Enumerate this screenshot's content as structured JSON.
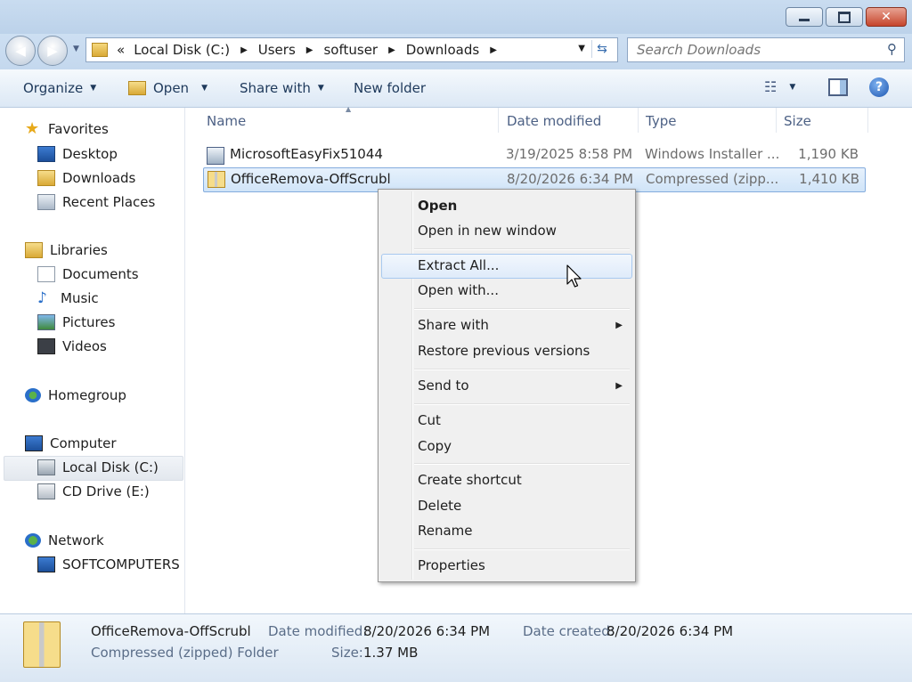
{
  "window": {
    "buttons": {
      "minimize": "minimize",
      "maximize": "maximize",
      "close": "close"
    }
  },
  "address": {
    "overflow": "«",
    "crumbs": [
      "Local Disk (C:)",
      "Users",
      "softuser",
      "Downloads"
    ],
    "search_placeholder": "Search Downloads"
  },
  "toolbar": {
    "organize": "Organize",
    "open": "Open",
    "share_with": "Share with",
    "new_folder": "New folder"
  },
  "sidebar": {
    "favorites": {
      "label": "Favorites",
      "items": [
        "Desktop",
        "Downloads",
        "Recent Places"
      ]
    },
    "libraries": {
      "label": "Libraries",
      "items": [
        "Documents",
        "Music",
        "Pictures",
        "Videos"
      ]
    },
    "homegroup": {
      "label": "Homegroup"
    },
    "computer": {
      "label": "Computer",
      "items": [
        "Local Disk (C:)",
        "CD Drive (E:)"
      ]
    },
    "network": {
      "label": "Network",
      "items": [
        "SOFTCOMPUTERS"
      ]
    }
  },
  "file_list": {
    "columns": [
      "Name",
      "Date modified",
      "Type",
      "Size"
    ],
    "rows": [
      {
        "name": "MicrosoftEasyFix51044",
        "date": "3/19/2025 8:58 PM",
        "type": "Windows Installer ...",
        "size": "1,190 KB"
      },
      {
        "name": "OfficeRemova-OffScrubl",
        "date": "8/20/2026 6:34 PM",
        "type": "Compressed (zipp...",
        "size": "1,410 KB"
      }
    ]
  },
  "context_menu": {
    "open": "Open",
    "open_new_window": "Open in new window",
    "extract_all": "Extract All...",
    "open_with": "Open with...",
    "share_with": "Share with",
    "restore": "Restore previous versions",
    "send_to": "Send to",
    "cut": "Cut",
    "copy": "Copy",
    "create_shortcut": "Create shortcut",
    "delete": "Delete",
    "rename": "Rename",
    "properties": "Properties"
  },
  "details": {
    "name": "OfficeRemova-OffScrubl",
    "type": "Compressed (zipped) Folder",
    "date_modified_label": "Date modified:",
    "date_modified": "8/20/2026 6:34 PM",
    "date_created_label": "Date created:",
    "date_created": "8/20/2026 6:34 PM",
    "size_label": "Size:",
    "size": "1.37 MB"
  }
}
